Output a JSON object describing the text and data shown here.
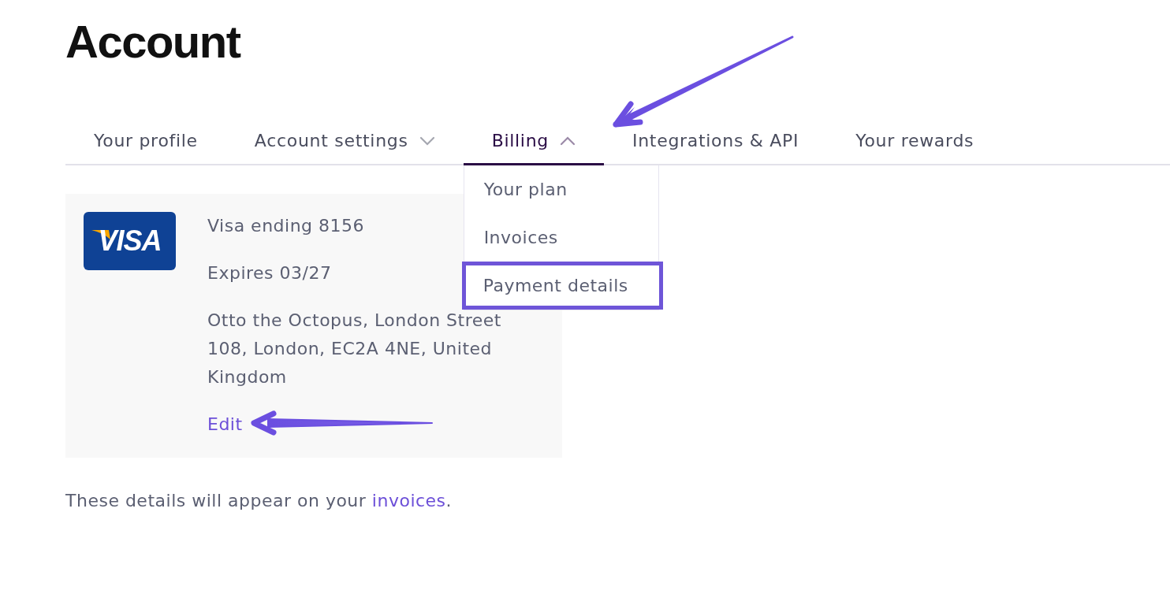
{
  "title": "Account",
  "tabs": [
    {
      "label": "Your profile",
      "selected": false,
      "kind": "plain"
    },
    {
      "label": "Account settings",
      "selected": false,
      "kind": "menu",
      "expanded": false
    },
    {
      "label": "Billing",
      "selected": true,
      "kind": "menu",
      "expanded": true
    },
    {
      "label": "Integrations & API",
      "selected": false,
      "kind": "plain"
    },
    {
      "label": "Your rewards",
      "selected": false,
      "kind": "plain"
    }
  ],
  "billing_menu": [
    {
      "label": "Your plan",
      "highlighted": false
    },
    {
      "label": "Invoices",
      "highlighted": false
    },
    {
      "label": "Payment details",
      "highlighted": true
    }
  ],
  "card": {
    "logo": "VISA",
    "lines": [
      "Visa ending 8156",
      "Expires 03/27",
      "Otto the Octopus, London Street 108, London, EC2A 4NE, United Kingdom"
    ],
    "edit": "Edit"
  },
  "note": {
    "text": "These details will appear on your ",
    "link": "invoices",
    "end": "."
  }
}
